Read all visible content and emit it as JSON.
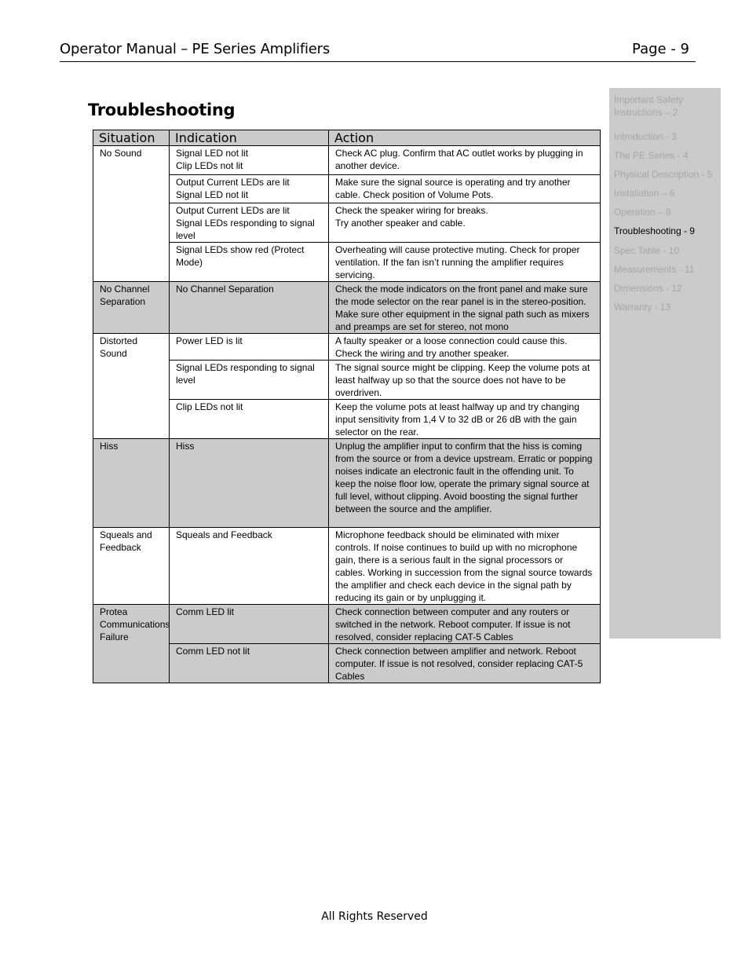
{
  "header": {
    "title": "Operator Manual – PE Series Amplifiers",
    "page": "Page - 9"
  },
  "heading": "Troubleshooting",
  "toc": {
    "items": [
      {
        "label": "Important Safety\nInstructions – 2",
        "active": false
      },
      {
        "label": "Introduction - 3",
        "active": false
      },
      {
        "label": "The PE Series - 4",
        "active": false
      },
      {
        "label": "Physical Description - 5",
        "active": false
      },
      {
        "label": "Installation – 6",
        "active": false
      },
      {
        "label": "Operation – 8",
        "active": false
      },
      {
        "label": "Troubleshooting - 9",
        "active": true
      },
      {
        "label": "Spec Table - 10",
        "active": false
      },
      {
        "label": "Measurements - 11",
        "active": false
      },
      {
        "label": "Dimensions - 12",
        "active": false
      },
      {
        "label": "Warranty - 13",
        "active": false
      }
    ]
  },
  "table": {
    "headers": [
      "Situation",
      "Indication",
      "Action"
    ],
    "groups": [
      {
        "situation": "No Sound",
        "shaded": false,
        "rows": [
          {
            "indication": "Signal LED not lit\nClip LEDs not lit",
            "action": "Check AC plug.  Confirm that AC outlet works by plugging in another device."
          },
          {
            "indication": "Output Current LEDs are lit\nSignal LED not lit",
            "action": "Make sure the signal source is operating and try another cable.  Check position of Volume Pots."
          },
          {
            "indication": "Output Current LEDs are lit\nSignal LEDs responding to signal level",
            "action": "Check the speaker wiring for breaks.\nTry another speaker and cable."
          },
          {
            "indication": "Signal LEDs show red (Protect Mode)",
            "action": "Overheating will cause protective muting. Check for proper ventilation.  If the fan isn’t running the amplifier requires servicing."
          }
        ]
      },
      {
        "situation": "No Channel\nSeparation",
        "shaded": true,
        "rows": [
          {
            "indication": "No Channel Separation",
            "action": "Check the mode indicators on the front panel and make sure the mode selector on the rear panel is in the stereo-position.  Make sure other equipment in the signal path such as mixers and preamps are set for stereo, not mono"
          }
        ]
      },
      {
        "situation": "Distorted Sound",
        "shaded": false,
        "rows": [
          {
            "indication": "Power LED is lit",
            "action": "A faulty speaker or a loose connection could cause this.  Check the wiring and try another speaker."
          },
          {
            "indication": "Signal LEDs responding to signal level",
            "action": "The signal source might be clipping. Keep the volume pots at least halfway up so that the source does not have to be overdriven."
          },
          {
            "indication": "Clip LEDs not lit",
            "action": "Keep the volume pots at least halfway up and try changing input sensitivity from 1,4 V to 32 dB or 26 dB with the gain selector on the rear."
          }
        ]
      },
      {
        "situation": "Hiss",
        "shaded": true,
        "rows": [
          {
            "indication": "Hiss",
            "action": "Unplug the amplifier input to confirm that the hiss is coming from the source or from a device upstream. Erratic or popping noises indicate an electronic fault in the offending unit.  To keep the noise floor low, operate the primary signal source at full level, without clipping.  Avoid boosting the signal further between the source and the amplifier."
          }
        ]
      },
      {
        "situation": "Squeals and\nFeedback",
        "shaded": false,
        "rows": [
          {
            "indication": "Squeals and Feedback",
            "action": "Microphone feedback should be eliminated with mixer controls. If noise continues to build up with no microphone gain, there is a serious fault in the signal processors or cables. Working in succession from the signal source towards the amplifier and check each device in the signal path by reducing its gain or by unplugging it."
          }
        ]
      },
      {
        "situation": "Protea\nCommunications\nFailure",
        "shaded": true,
        "rows": [
          {
            "indication": "Comm LED lit",
            "action": "Check connection between computer and any routers or switched in the network.  Reboot computer.  If issue is not resolved, consider replacing CAT-5 Cables"
          },
          {
            "indication": "Comm LED not lit",
            "action": "Check connection between amplifier and network. Reboot computer.  If issue is not resolved, consider replacing CAT-5 Cables"
          }
        ]
      }
    ]
  },
  "footer": "All Rights Reserved"
}
